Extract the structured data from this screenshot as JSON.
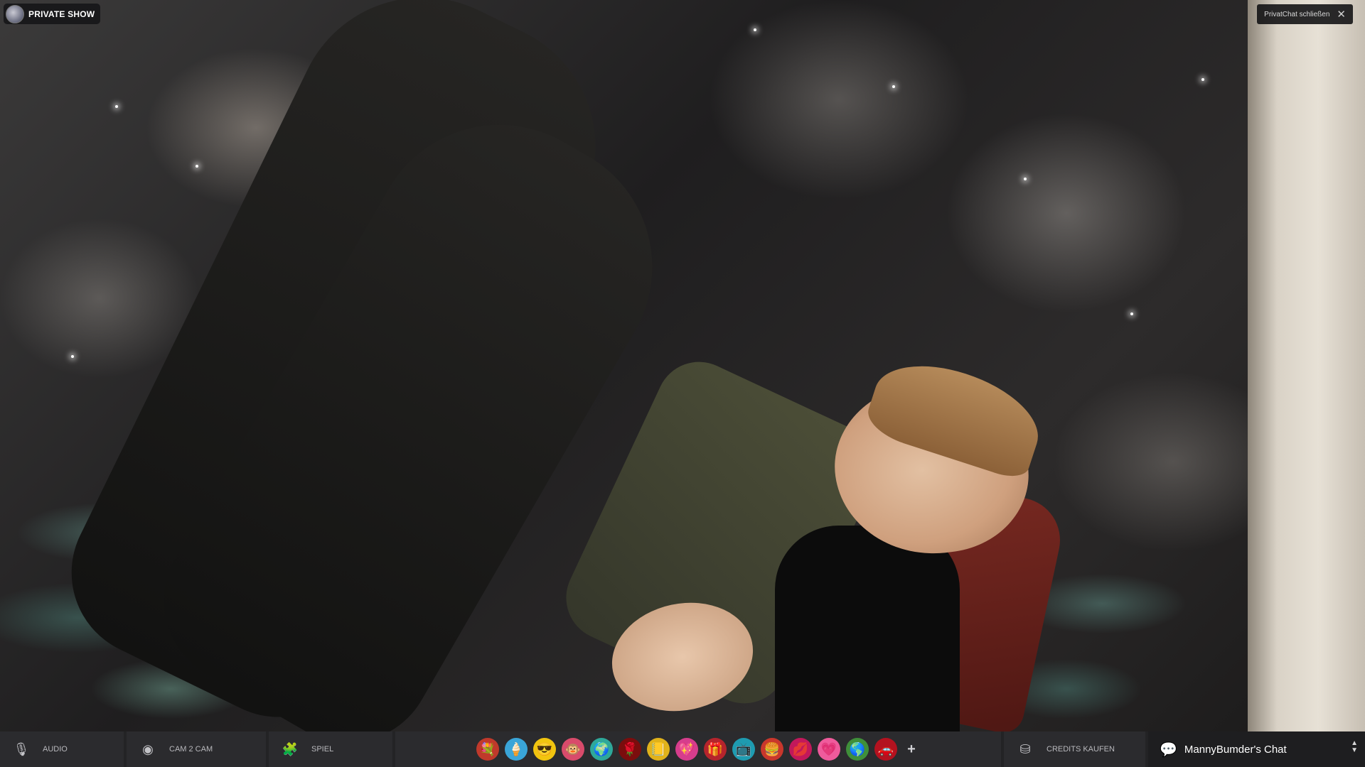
{
  "stream": {
    "show_label": "PRIVATE SHOW",
    "close_chat_label": "PrivatChat schließen"
  },
  "toolbar": {
    "audio_label": "AUDIO",
    "cam2cam_label": "CAM 2 CAM",
    "game_label": "SPIEL",
    "credits_label": "CREDITS KAUFEN",
    "chat_label": "MannyBumder's Chat",
    "gifts": [
      {
        "icon": "flower-bouquet-icon",
        "glyph": "💐",
        "color": "#c0392b"
      },
      {
        "icon": "ice-cream-icon",
        "glyph": "🍦",
        "color": "#3aa5d8"
      },
      {
        "icon": "sunglasses-icon",
        "glyph": "😎",
        "color": "#f1c40f"
      },
      {
        "icon": "monkey-icon",
        "glyph": "🐵",
        "color": "#d94b6b"
      },
      {
        "icon": "globe-icon",
        "glyph": "🌍",
        "color": "#2ea89a"
      },
      {
        "icon": "rose-icon",
        "glyph": "🌹",
        "color": "#7b0d0d"
      },
      {
        "icon": "note-icon",
        "glyph": "📒",
        "color": "#e0b21b"
      },
      {
        "icon": "perfume-icon",
        "glyph": "💖",
        "color": "#d63d8c"
      },
      {
        "icon": "gift-box-icon",
        "glyph": "🎁",
        "color": "#b5242c"
      },
      {
        "icon": "monitor-icon",
        "glyph": "📺",
        "color": "#1e9bb0"
      },
      {
        "icon": "hamburger-icon",
        "glyph": "🍔",
        "color": "#c9372c"
      },
      {
        "icon": "lips-icon",
        "glyph": "💋",
        "color": "#c2185b"
      },
      {
        "icon": "heart-icon",
        "glyph": "💗",
        "color": "#ef5b9c"
      },
      {
        "icon": "earth-icon",
        "glyph": "🌎",
        "color": "#3f8f3a"
      },
      {
        "icon": "car-icon",
        "glyph": "🚗",
        "color": "#b3121f"
      }
    ],
    "more_gifts": "+"
  }
}
